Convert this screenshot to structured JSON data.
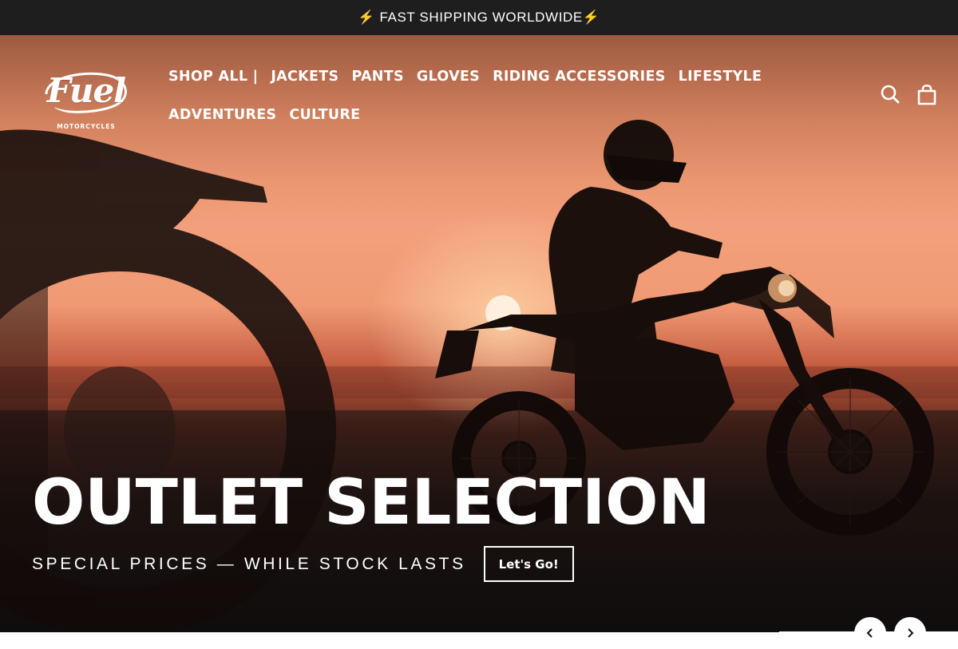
{
  "announcement": {
    "text": "⚡ FAST SHIPPING WORLDWIDE⚡"
  },
  "logo": {
    "wordmark": "Fuel",
    "subtitle": "MOTORCYCLES"
  },
  "nav": {
    "items": [
      {
        "label": "SHOP ALL |"
      },
      {
        "label": "JACKETS"
      },
      {
        "label": "PANTS"
      },
      {
        "label": "GLOVES"
      },
      {
        "label": "RIDING ACCESSORIES"
      },
      {
        "label": "LIFESTYLE"
      },
      {
        "label": "ADVENTURES"
      },
      {
        "label": "CULTURE"
      }
    ]
  },
  "header_icons": [
    "search-icon",
    "cart-icon"
  ],
  "hero": {
    "title": "OUTLET SELECTION",
    "subtitle": "SPECIAL PRICES — WHILE STOCK LASTS",
    "cta_label": "Let's Go!"
  },
  "slider": {
    "controls": [
      "chevron-left-icon",
      "chevron-right-icon"
    ]
  },
  "colors": {
    "announcement_bg": "#1e1e1f",
    "text_on_hero": "#ffffff",
    "sunset_orange": "#f09a74"
  }
}
